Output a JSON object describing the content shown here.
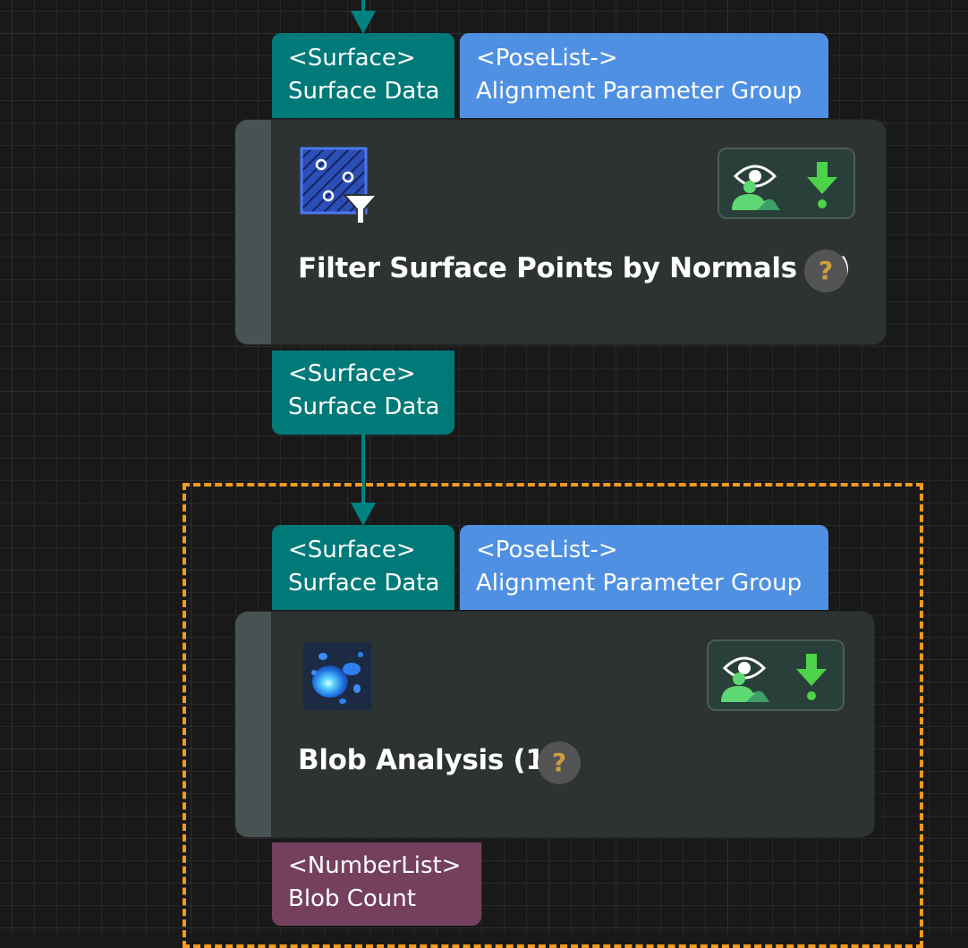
{
  "canvas": {
    "background": "#191919",
    "grid_color": "#2e2e2e",
    "link_color": "#008282",
    "selection_color": "#f29a1e"
  },
  "steps": [
    {
      "title": "Filter Surface Points by Normals (1)",
      "icon": "filter-surface-icon",
      "help": "?",
      "inputs": [
        {
          "type": "<Surface>",
          "name": "Surface Data",
          "color": "#007a78"
        },
        {
          "type": "<PoseList->",
          "name": "Alignment Parameter Group",
          "color": "#4f90e3"
        }
      ],
      "outputs": [
        {
          "type": "<Surface>",
          "name": "Surface Data",
          "color": "#007a78"
        }
      ],
      "tools": [
        "visualize-output-icon",
        "debug-output-icon"
      ],
      "selected": false
    },
    {
      "title": "Blob Analysis (1)",
      "icon": "blob-analysis-icon",
      "help": "?",
      "inputs": [
        {
          "type": "<Surface>",
          "name": "Surface Data",
          "color": "#007a78"
        },
        {
          "type": "<PoseList->",
          "name": "Alignment Parameter Group",
          "color": "#4f90e3"
        }
      ],
      "outputs": [
        {
          "type": "<NumberList>",
          "name": "Blob Count",
          "color": "#74405e"
        }
      ],
      "tools": [
        "visualize-output-icon",
        "debug-output-icon"
      ],
      "selected": true
    }
  ]
}
